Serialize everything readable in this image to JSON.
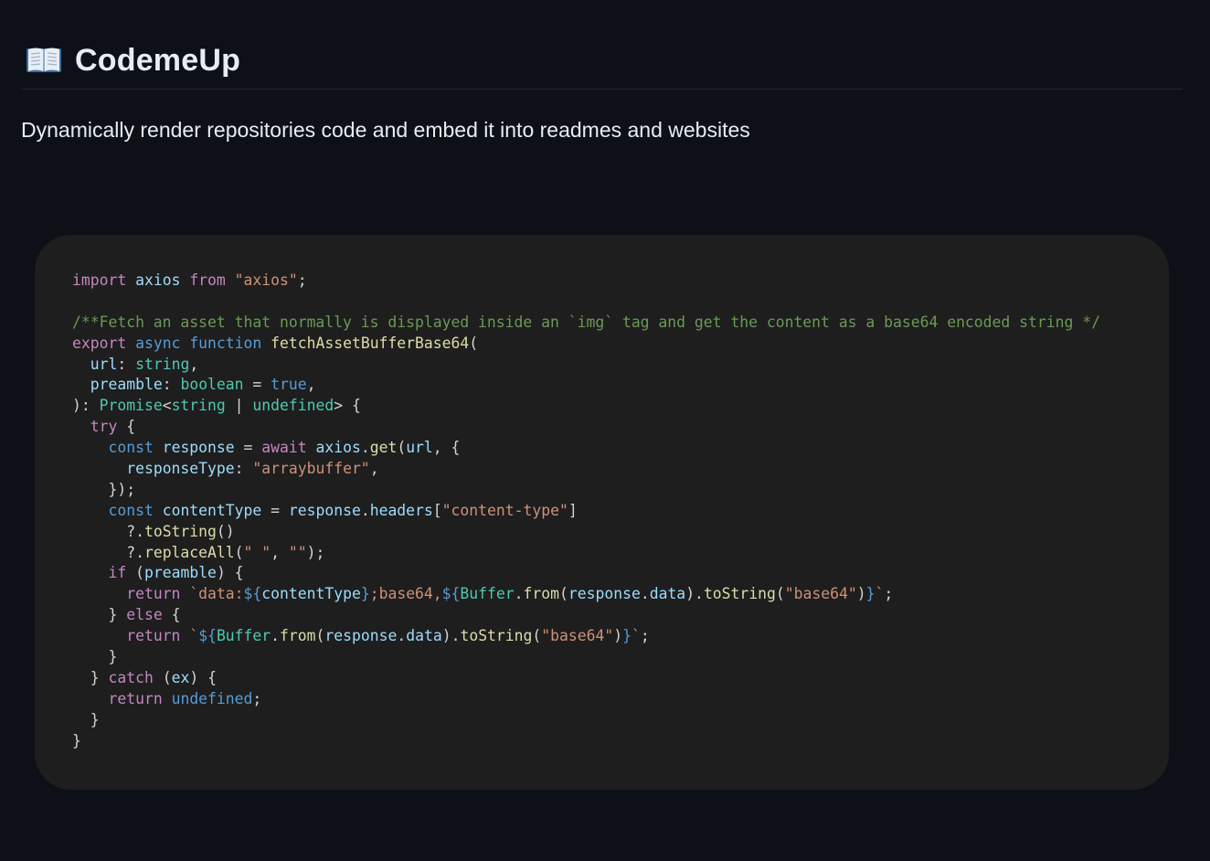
{
  "header": {
    "icon": "open-book-icon",
    "title": "CodemeUp"
  },
  "description": "Dynamically render repositories code and embed it into readmes and websites",
  "code_block": {
    "language": "typescript",
    "lines": [
      [
        [
          "keyword",
          "import"
        ],
        [
          "plain",
          " "
        ],
        [
          "variable",
          "axios"
        ],
        [
          "plain",
          " "
        ],
        [
          "keyword",
          "from"
        ],
        [
          "plain",
          " "
        ],
        [
          "string",
          "\"axios\""
        ],
        [
          "plain",
          ";"
        ]
      ],
      [],
      [
        [
          "comment",
          "/**Fetch an asset that normally is displayed inside an `img` tag and get the content as a base64 encoded string */"
        ]
      ],
      [
        [
          "keyword",
          "export"
        ],
        [
          "plain",
          " "
        ],
        [
          "storage",
          "async"
        ],
        [
          "plain",
          " "
        ],
        [
          "storage",
          "function"
        ],
        [
          "plain",
          " "
        ],
        [
          "function",
          "fetchAssetBufferBase64"
        ],
        [
          "plain",
          "("
        ]
      ],
      [
        [
          "plain",
          "  "
        ],
        [
          "variable",
          "url"
        ],
        [
          "plain",
          ": "
        ],
        [
          "type",
          "string"
        ],
        [
          "plain",
          ","
        ]
      ],
      [
        [
          "plain",
          "  "
        ],
        [
          "variable",
          "preamble"
        ],
        [
          "plain",
          ": "
        ],
        [
          "type",
          "boolean"
        ],
        [
          "plain",
          " = "
        ],
        [
          "storage",
          "true"
        ],
        [
          "plain",
          ","
        ]
      ],
      [
        [
          "plain",
          "): "
        ],
        [
          "class",
          "Promise"
        ],
        [
          "plain",
          "<"
        ],
        [
          "type",
          "string"
        ],
        [
          "plain",
          " | "
        ],
        [
          "type",
          "undefined"
        ],
        [
          "plain",
          "> {"
        ]
      ],
      [
        [
          "plain",
          "  "
        ],
        [
          "keyword",
          "try"
        ],
        [
          "plain",
          " {"
        ]
      ],
      [
        [
          "plain",
          "    "
        ],
        [
          "storage",
          "const"
        ],
        [
          "plain",
          " "
        ],
        [
          "variable",
          "response"
        ],
        [
          "plain",
          " = "
        ],
        [
          "keyword",
          "await"
        ],
        [
          "plain",
          " "
        ],
        [
          "variable",
          "axios"
        ],
        [
          "plain",
          "."
        ],
        [
          "function",
          "get"
        ],
        [
          "plain",
          "("
        ],
        [
          "variable",
          "url"
        ],
        [
          "plain",
          ", {"
        ]
      ],
      [
        [
          "plain",
          "      "
        ],
        [
          "variable",
          "responseType"
        ],
        [
          "plain",
          ": "
        ],
        [
          "string",
          "\"arraybuffer\""
        ],
        [
          "plain",
          ","
        ]
      ],
      [
        [
          "plain",
          "    });"
        ]
      ],
      [
        [
          "plain",
          "    "
        ],
        [
          "storage",
          "const"
        ],
        [
          "plain",
          " "
        ],
        [
          "variable",
          "contentType"
        ],
        [
          "plain",
          " = "
        ],
        [
          "variable",
          "response"
        ],
        [
          "plain",
          "."
        ],
        [
          "variable",
          "headers"
        ],
        [
          "plain",
          "["
        ],
        [
          "string",
          "\"content-type\""
        ],
        [
          "plain",
          "]"
        ]
      ],
      [
        [
          "plain",
          "      ?."
        ],
        [
          "function",
          "toString"
        ],
        [
          "plain",
          "()"
        ]
      ],
      [
        [
          "plain",
          "      ?."
        ],
        [
          "function",
          "replaceAll"
        ],
        [
          "plain",
          "("
        ],
        [
          "string",
          "\" \""
        ],
        [
          "plain",
          ", "
        ],
        [
          "string",
          "\"\""
        ],
        [
          "plain",
          ");"
        ]
      ],
      [
        [
          "plain",
          "    "
        ],
        [
          "keyword",
          "if"
        ],
        [
          "plain",
          " ("
        ],
        [
          "variable",
          "preamble"
        ],
        [
          "plain",
          ") {"
        ]
      ],
      [
        [
          "plain",
          "      "
        ],
        [
          "keyword",
          "return"
        ],
        [
          "plain",
          " "
        ],
        [
          "string",
          "`data:"
        ],
        [
          "interp",
          "${"
        ],
        [
          "variable",
          "contentType"
        ],
        [
          "interp",
          "}"
        ],
        [
          "string",
          ";base64,"
        ],
        [
          "interp",
          "${"
        ],
        [
          "class",
          "Buffer"
        ],
        [
          "plain",
          "."
        ],
        [
          "function",
          "from"
        ],
        [
          "plain",
          "("
        ],
        [
          "variable",
          "response"
        ],
        [
          "plain",
          "."
        ],
        [
          "variable",
          "data"
        ],
        [
          "plain",
          ")."
        ],
        [
          "function",
          "toString"
        ],
        [
          "plain",
          "("
        ],
        [
          "string",
          "\"base64\""
        ],
        [
          "plain",
          ")"
        ],
        [
          "interp",
          "}"
        ],
        [
          "string",
          "`"
        ],
        [
          "plain",
          ";"
        ]
      ],
      [
        [
          "plain",
          "    } "
        ],
        [
          "keyword",
          "else"
        ],
        [
          "plain",
          " {"
        ]
      ],
      [
        [
          "plain",
          "      "
        ],
        [
          "keyword",
          "return"
        ],
        [
          "plain",
          " "
        ],
        [
          "string",
          "`"
        ],
        [
          "interp",
          "${"
        ],
        [
          "class",
          "Buffer"
        ],
        [
          "plain",
          "."
        ],
        [
          "function",
          "from"
        ],
        [
          "plain",
          "("
        ],
        [
          "variable",
          "response"
        ],
        [
          "plain",
          "."
        ],
        [
          "variable",
          "data"
        ],
        [
          "plain",
          ")."
        ],
        [
          "function",
          "toString"
        ],
        [
          "plain",
          "("
        ],
        [
          "string",
          "\"base64\""
        ],
        [
          "plain",
          ")"
        ],
        [
          "interp",
          "}"
        ],
        [
          "string",
          "`"
        ],
        [
          "plain",
          ";"
        ]
      ],
      [
        [
          "plain",
          "    }"
        ]
      ],
      [
        [
          "plain",
          "  } "
        ],
        [
          "keyword",
          "catch"
        ],
        [
          "plain",
          " ("
        ],
        [
          "variable",
          "ex"
        ],
        [
          "plain",
          ") {"
        ]
      ],
      [
        [
          "plain",
          "    "
        ],
        [
          "keyword",
          "return"
        ],
        [
          "plain",
          " "
        ],
        [
          "storage",
          "undefined"
        ],
        [
          "plain",
          ";"
        ]
      ],
      [
        [
          "plain",
          "  }"
        ]
      ],
      [
        [
          "plain",
          "}"
        ]
      ]
    ]
  }
}
